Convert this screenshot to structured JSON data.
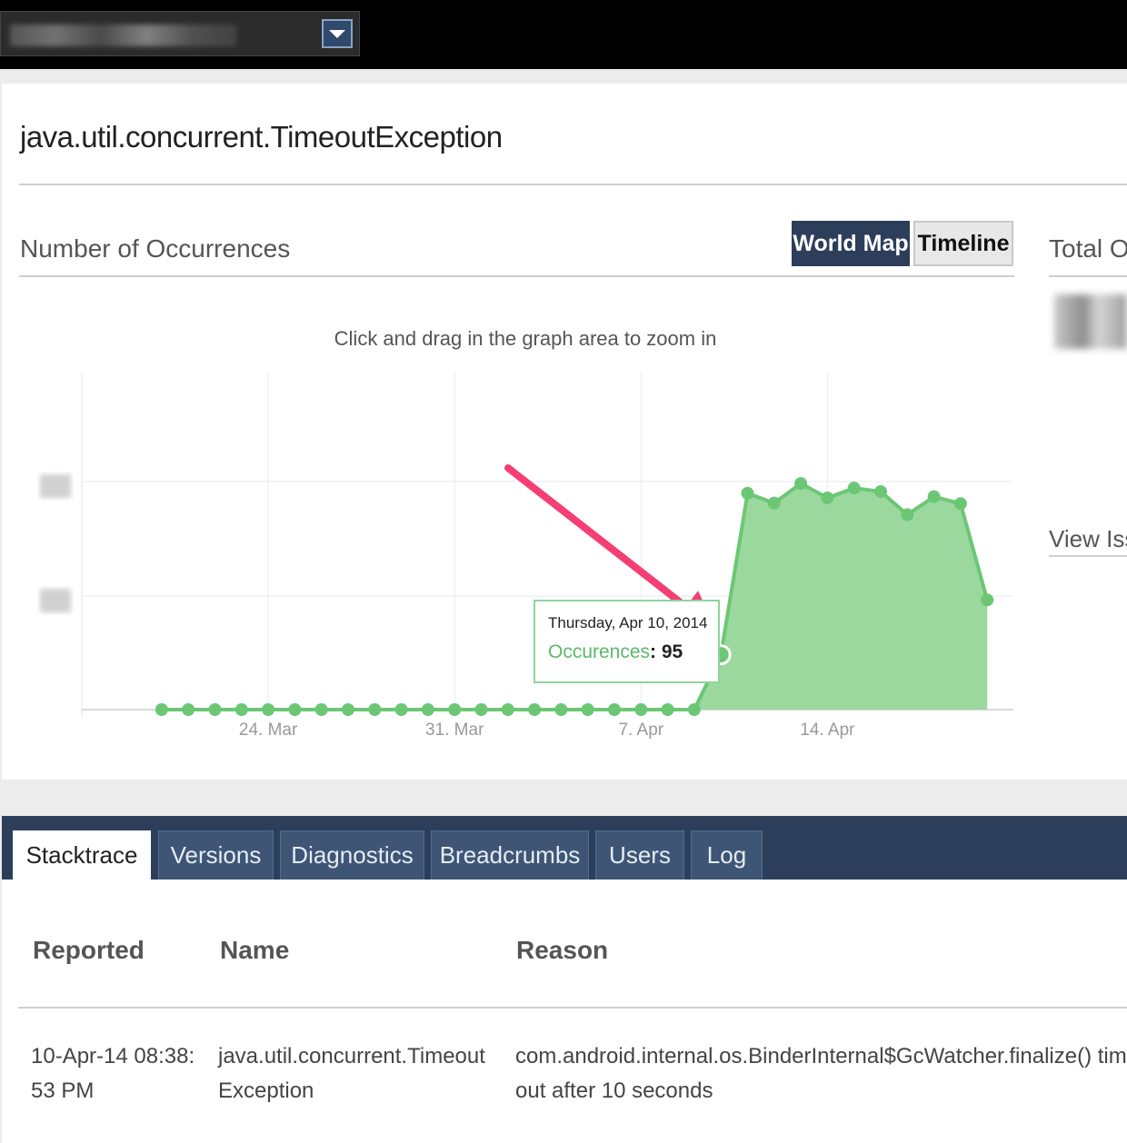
{
  "issue": {
    "title": "java.util.concurrent.TimeoutException"
  },
  "chart_section": {
    "title": "Number of Occurrences",
    "buttons": {
      "world_map": "World Map",
      "timeline": "Timeline"
    },
    "hint": "Click and drag in the graph area to zoom in"
  },
  "side_panel": {
    "title": "Total Oc",
    "link": "View Iss"
  },
  "tooltip": {
    "date": "Thursday, Apr 10, 2014",
    "label": "Occurences",
    "separator": ": ",
    "value": "95"
  },
  "colors": {
    "series_fill": "#9ad89e",
    "series_line": "#6cc775",
    "annotation_arrow": "#f43e74",
    "header_bg": "#2c3e5a"
  },
  "chart_data": {
    "type": "area",
    "x": [
      "2014-03-20",
      "2014-03-21",
      "2014-03-22",
      "2014-03-23",
      "2014-03-24",
      "2014-03-25",
      "2014-03-26",
      "2014-03-27",
      "2014-03-28",
      "2014-03-29",
      "2014-03-30",
      "2014-03-31",
      "2014-04-01",
      "2014-04-02",
      "2014-04-03",
      "2014-04-04",
      "2014-04-05",
      "2014-04-06",
      "2014-04-07",
      "2014-04-08",
      "2014-04-09",
      "2014-04-10",
      "2014-04-11",
      "2014-04-12",
      "2014-04-13",
      "2014-04-14",
      "2014-04-15",
      "2014-04-16",
      "2014-04-17",
      "2014-04-18",
      "2014-04-19",
      "2014-04-20"
    ],
    "series": [
      {
        "values": [
          0,
          0,
          0,
          0,
          0,
          0,
          0,
          0,
          0,
          0,
          0,
          0,
          0,
          0,
          0,
          0,
          0,
          0,
          0,
          0,
          0,
          95,
          375,
          358,
          392,
          367,
          384,
          378,
          338,
          369,
          357,
          190
        ]
      }
    ],
    "tick_labels": [
      "24. Mar",
      "31. Mar",
      "7. Apr",
      "14. Apr"
    ],
    "highlighted_point": {
      "x": "2014-04-10",
      "y": 95
    },
    "ylim": [
      0,
      400
    ],
    "grid": true
  },
  "tabs": [
    {
      "label": "Stacktrace",
      "active": true
    },
    {
      "label": "Versions",
      "active": false
    },
    {
      "label": "Diagnostics",
      "active": false
    },
    {
      "label": "Breadcrumbs",
      "active": false
    },
    {
      "label": "Users",
      "active": false
    },
    {
      "label": "Log",
      "active": false
    }
  ],
  "table": {
    "headers": [
      "Reported",
      "Name",
      "Reason"
    ],
    "row": {
      "reported": [
        "10-Apr-14 08:38:",
        "53 PM"
      ],
      "name": [
        "java.util.concurrent.Timeout",
        "Exception"
      ],
      "reason": [
        "com.android.internal.os.BinderInternal$GcWatcher.finalize() time",
        "out after 10 seconds"
      ]
    }
  }
}
